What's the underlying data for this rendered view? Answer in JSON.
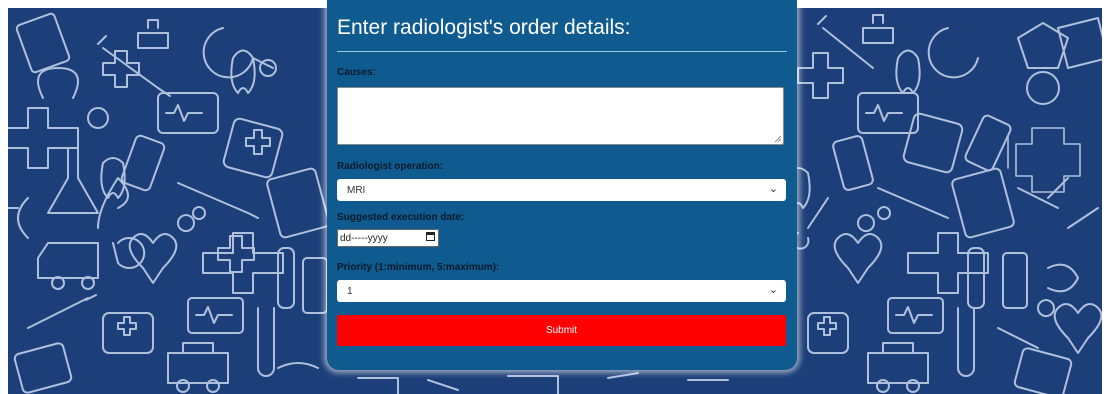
{
  "form": {
    "title": "Enter radiologist's order details:",
    "causes_label": "Causes:",
    "causes_value": "",
    "operation_label": "Radiologist operation:",
    "operation_value": "MRI",
    "date_label": "Suggested execution date:",
    "date_placeholder": "dd-----yyyy",
    "priority_label": "Priority (1:minimum, 5:maximum):",
    "priority_value": "1",
    "submit_label": "Submit"
  },
  "colors": {
    "background_pattern": "#1d3f79",
    "panel": "#0f5a8f",
    "submit": "#fe0000"
  }
}
